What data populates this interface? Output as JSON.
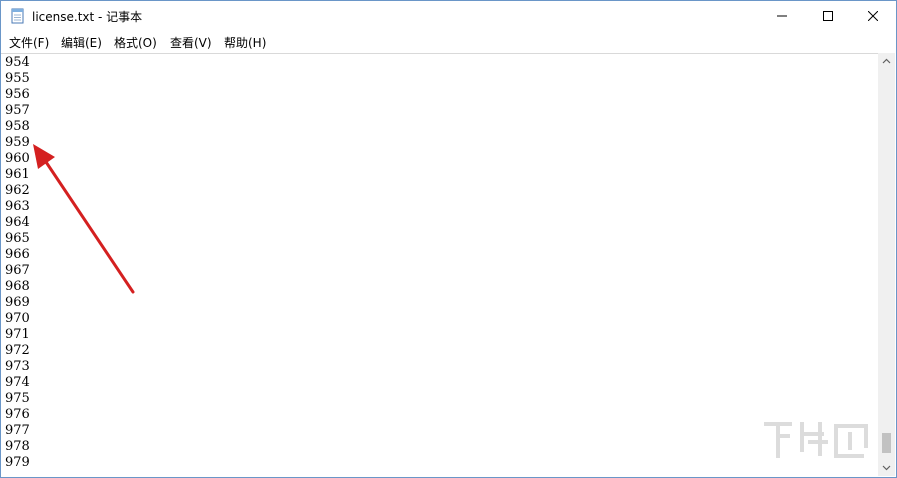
{
  "window": {
    "title": "license.txt - 记事本",
    "icon": "notepad-icon",
    "controls": {
      "minimize": "minimize-icon",
      "maximize": "maximize-icon",
      "close": "close-icon"
    }
  },
  "menu": [
    "文件(F)",
    "编辑(E)",
    "格式(O)",
    "查看(V)",
    "帮助(H)"
  ],
  "lines": [
    "954",
    "955",
    "956",
    "957",
    "958",
    "959",
    "960",
    "961",
    "962",
    "963",
    "964",
    "965",
    "966",
    "967",
    "968",
    "969",
    "970",
    "971",
    "972",
    "973",
    "974",
    "975",
    "976",
    "977",
    "978",
    "979"
  ],
  "scrollbar": {
    "up": "chevron-up-icon",
    "down": "chevron-down-icon"
  },
  "annotation": {
    "type": "red-arrow",
    "color": "#d42020"
  },
  "colors": {
    "border": "#6a96c8",
    "scroll_track": "#f0f0f0",
    "arrow": "#d42020"
  },
  "watermark_text": "下载吧"
}
